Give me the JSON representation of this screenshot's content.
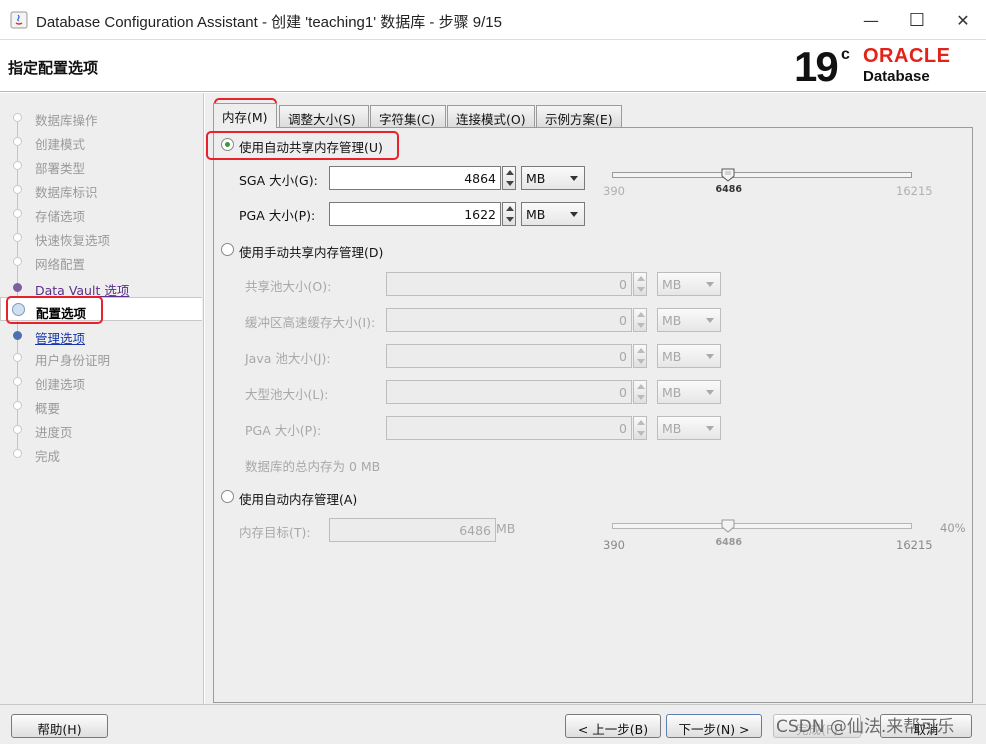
{
  "window": {
    "title": "Database Configuration Assistant - 创建 'teaching1' 数据库 - 步骤 9/15",
    "minimize": "—",
    "maximize": "☐",
    "close": "✕"
  },
  "header": {
    "page_title": "指定配置选项",
    "logo_version": "19",
    "logo_suffix": "c",
    "logo_brand": "ORACLE",
    "logo_product": "Database",
    "brand_color": "#e2231a"
  },
  "sidebar": {
    "items": [
      {
        "label": "数据库操作",
        "state": "disabled"
      },
      {
        "label": "创建模式",
        "state": "disabled"
      },
      {
        "label": "部署类型",
        "state": "disabled"
      },
      {
        "label": "数据库标识",
        "state": "disabled"
      },
      {
        "label": "存储选项",
        "state": "disabled"
      },
      {
        "label": "快速恢复选项",
        "state": "disabled"
      },
      {
        "label": "网络配置",
        "state": "disabled"
      },
      {
        "label": "Data Vault 选项",
        "state": "visited"
      },
      {
        "label": "配置选项",
        "state": "current"
      },
      {
        "label": "管理选项",
        "state": "link"
      },
      {
        "label": "用户身份证明",
        "state": "disabled"
      },
      {
        "label": "创建选项",
        "state": "disabled"
      },
      {
        "label": "概要",
        "state": "disabled"
      },
      {
        "label": "进度页",
        "state": "disabled"
      },
      {
        "label": "完成",
        "state": "disabled"
      }
    ]
  },
  "tabs": [
    {
      "label": "内存(M)",
      "active": true
    },
    {
      "label": "调整大小(S)",
      "active": false
    },
    {
      "label": "字符集(C)",
      "active": false
    },
    {
      "label": "连接模式(O)",
      "active": false
    },
    {
      "label": "示例方案(E)",
      "active": false
    }
  ],
  "memory": {
    "asmm": {
      "label": "使用自动共享内存管理(U)",
      "selected": true,
      "sga_label": "SGA 大小(G):",
      "sga_value": "4864",
      "sga_unit": "MB",
      "pga_label": "PGA 大小(P):",
      "pga_value": "1622",
      "pga_unit": "MB",
      "slider_min": "390",
      "slider_max": "16215",
      "slider_value": "6486",
      "slider_fraction": 0.385
    },
    "manual": {
      "label": "使用手动共享内存管理(D)",
      "selected": false,
      "fields": [
        {
          "label": "共享池大小(O):",
          "value": "0",
          "unit": "MB"
        },
        {
          "label": "缓冲区高速缓存大小(I):",
          "value": "0",
          "unit": "MB"
        },
        {
          "label": "Java 池大小(J):",
          "value": "0",
          "unit": "MB"
        },
        {
          "label": "大型池大小(L):",
          "value": "0",
          "unit": "MB"
        },
        {
          "label": "PGA 大小(P):",
          "value": "0",
          "unit": "MB"
        }
      ],
      "total_label": "数据库的总内存为 0 MB"
    },
    "amm": {
      "label": "使用自动内存管理(A)",
      "selected": false,
      "target_label": "内存目标(T):",
      "target_value": "6486",
      "target_unit": "MB",
      "slider_min": "390",
      "slider_max": "16215",
      "slider_value": "6486",
      "slider_percent": "40%",
      "slider_fraction": 0.385
    }
  },
  "footer": {
    "help": "帮助(H)",
    "back": "< 上一步(B)",
    "next": "下一步(N) >",
    "finish": "完成(F)",
    "cancel": "取消"
  },
  "watermark": "CSDN @仙法.来帮可乐"
}
